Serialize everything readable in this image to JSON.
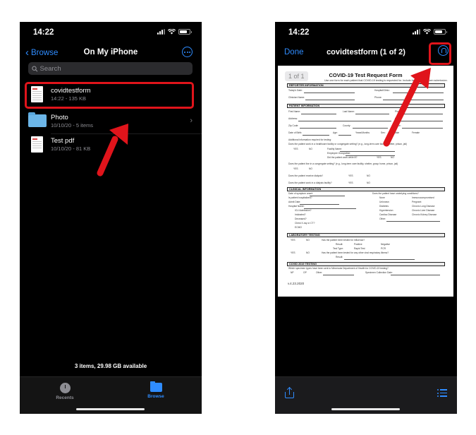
{
  "colors": {
    "accent": "#2f8cff",
    "highlight": "#e0141b",
    "background": "#000000"
  },
  "left_phone": {
    "status": {
      "time": "14:22"
    },
    "nav": {
      "back_label": "Browse",
      "title": "On My iPhone"
    },
    "search": {
      "placeholder": "Search"
    },
    "files": [
      {
        "name": "covidtestform",
        "meta": "14:22 - 135 KB",
        "icon": "pdf-thumbnail-icon"
      },
      {
        "name": "Photo",
        "meta": "10/10/20 - 5 items",
        "icon": "folder-icon"
      },
      {
        "name": "Test pdf",
        "meta": "10/10/20 - 81 KB",
        "icon": "pdf-thumbnail-icon"
      }
    ],
    "footer": "3 items, 29.98 GB available",
    "tabs": [
      {
        "label": "Recents",
        "icon": "clock-icon"
      },
      {
        "label": "Browse",
        "icon": "folder-icon"
      }
    ]
  },
  "right_phone": {
    "status": {
      "time": "14:22"
    },
    "nav": {
      "done_label": "Done",
      "title": "covidtestform (1 of 2)"
    },
    "page_badge": "1 of 1",
    "document": {
      "title": "COVID-19 Test Request Form",
      "subtitle": "Use one form for each patient that COVID-19 testing is requested for. Include form with specimen submission.",
      "sections": [
        "REPORTER INFORMATION",
        "PATIENT INFORMATION",
        "CLINICAL INFORMATION",
        "LABORATORY TESTING",
        "COVID 2019 TESTING"
      ],
      "fields": {
        "todays_date": "Today's Date:",
        "hospital": "Hospital/Clinic:",
        "clinician": "Clinician Name:",
        "phone": "Phone:",
        "first_name": "First Name:",
        "last_name": "Last Name:",
        "phone2": "Phone:",
        "address": "Address:",
        "city": "City:",
        "zip": "Zip Code:",
        "county": "County:",
        "state": "State:",
        "dob": "Date of Birth:",
        "age": "Age:",
        "years_months": "Years/Months",
        "sex": "Sex:",
        "male": "Male",
        "female": "Female",
        "additional": "Additional information required for testing:",
        "q_healthcare": "Does the patient work in a healthcare facility or congregate setting? (e.g., long-term care facility, shelter, prison, jail)",
        "facility_name": "Facility Name:",
        "employee_occ": "Employee Occupation:",
        "q_work_ill": "Did the patient work while ill?",
        "q_congregate": "Does the patient live in a congregate setting? (e.g., long-term care facility, shelter, group home, prison, jail)",
        "q_dialysis": "Does the patient receive dialysis?",
        "q_dialysis_facility": "Does the patient work in a dialysis facility?",
        "yes": "YES",
        "no": "NO",
        "onset": "Date of symptom onset:",
        "hospitalized": "Is patient hospitalized?",
        "admit": "Admit Date:",
        "hospital_name": "Hospital Name:",
        "icu": "ICU Admission?",
        "intubated": "Intubated?",
        "deceased": "Deceased?",
        "xray": "Chest X-ray or CT?",
        "ecmo": "ECMO",
        "underlying": "Does the patient have underlying conditions?",
        "cond_none": "None",
        "cond_unknown": "Unknown",
        "cond_diabetes": "Diabetes",
        "cond_hypertension": "Hypertension",
        "cond_cardiac": "Cardiac Disease",
        "cond_other": "Other:",
        "cond_immuno": "Immunocompromised",
        "cond_pregnant": "Pregnant",
        "cond_lung": "Chronic Lung Disease",
        "cond_liver": "Chronic Liver Disease",
        "cond_kidney": "Chronic Kidney Disease",
        "flu_tested": "Has the patient been tested for influenza?",
        "result": "Result:",
        "positive": "Positive",
        "negative": "Negative",
        "test_type": "Test Type:",
        "rapid": "Rapid Test",
        "pcr": "PCR",
        "other_resp": "Has the patient been tested for any other viral respiratory illness?",
        "which_specimen": "Which specimen types have been sent to Minnesota Department of Health for COVID-19 testing?",
        "np": "NP",
        "op": "OP",
        "other": "Other:",
        "collection": "Specimen Collection Date:"
      },
      "footer": "v.4.23.2020"
    },
    "toolbar": {
      "share_icon": "share-icon",
      "list_icon": "list-icon"
    }
  }
}
